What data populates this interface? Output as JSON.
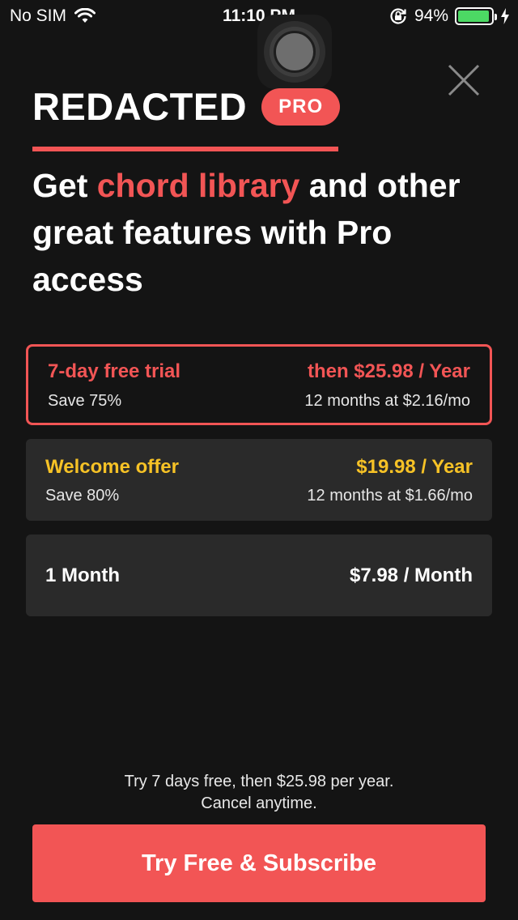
{
  "status_bar": {
    "carrier": "No SIM",
    "time": "11:10 PM",
    "battery_percent": "94%",
    "battery_level": 0.94,
    "battery_color": "#4cd964"
  },
  "header": {
    "brand": "REDACTED",
    "badge": "PRO",
    "close_icon": "close-icon"
  },
  "headline": {
    "prefix": "Get ",
    "highlight": "chord library",
    "suffix": " and other great features with Pro access"
  },
  "plans": [
    {
      "title": "7-day free trial",
      "price": "then $25.98 / Year",
      "save": "Save 75%",
      "detail": "12 months at $2.16/mo",
      "selected": true
    },
    {
      "title": "Welcome offer",
      "price": "$19.98 / Year",
      "save": "Save 80%",
      "detail": "12 months at $1.66/mo",
      "selected": false
    },
    {
      "title": "1 Month",
      "price": "$7.98 / Month",
      "selected": false
    }
  ],
  "footer": {
    "note_line1": "Try 7 days free, then $25.98 per year.",
    "note_line2": "Cancel anytime.",
    "cta": "Try Free & Subscribe"
  },
  "colors": {
    "accent": "#f25555",
    "offer": "#f6c226",
    "background": "#141414",
    "card": "#2a2a2a"
  }
}
